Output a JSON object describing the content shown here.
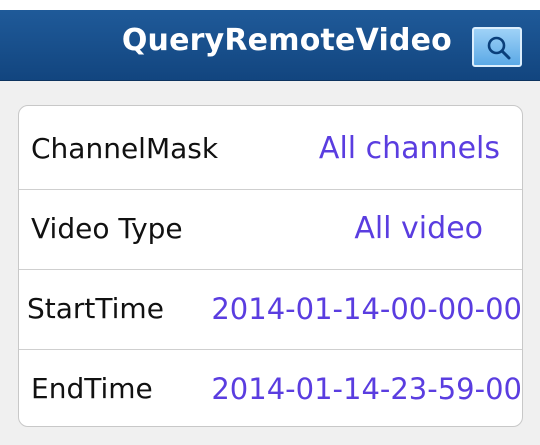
{
  "header": {
    "title": "QueryRemoteVideo",
    "search_icon": "search-icon"
  },
  "form": {
    "rows": [
      {
        "label": "ChannelMask",
        "value": "All channels"
      },
      {
        "label": "Video Type",
        "value": "All video"
      },
      {
        "label": "StartTime",
        "value": "2014-01-14-00-00-00"
      },
      {
        "label": "EndTime",
        "value": "2014-01-14-23-59-00"
      }
    ]
  },
  "colors": {
    "titlebar": "#1a4f8b",
    "value_text": "#5a3de0",
    "background": "#f0f0f0",
    "search_button": "#6fb6ea"
  }
}
